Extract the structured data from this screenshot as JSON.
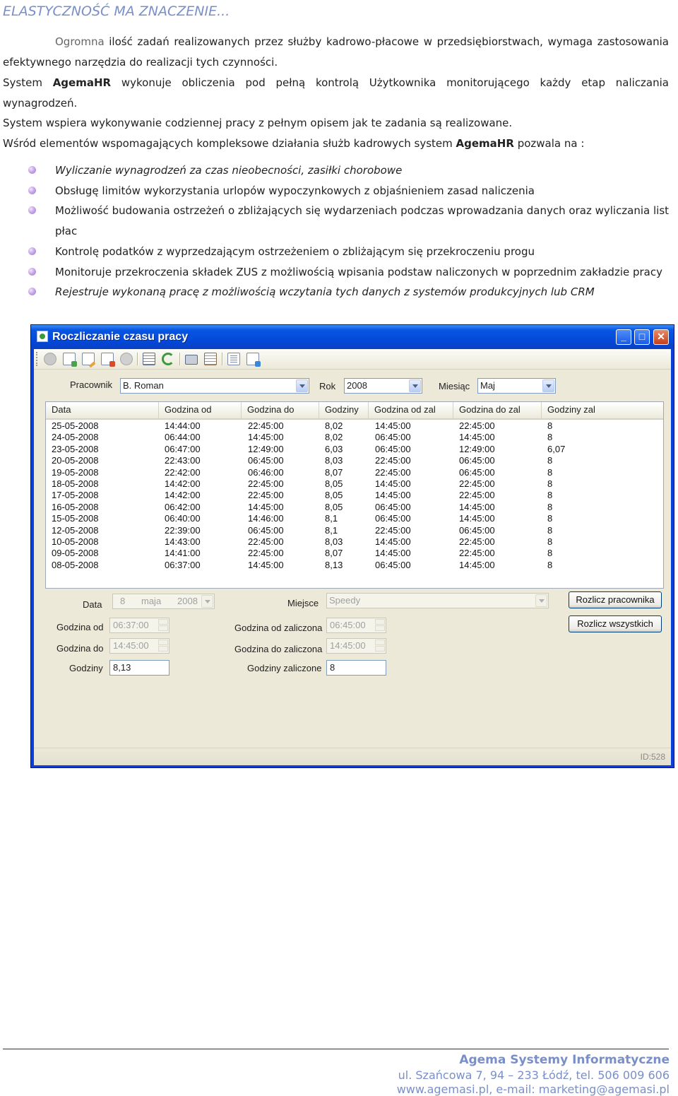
{
  "doc": {
    "title": "ELASTYCZNOŚĆ MA ZNACZENIE...",
    "p1_lead": "Ogromna",
    "p1_rest": " ilość zadań realizowanych przez służby kadrowo-płacowe w przedsiębiorstwach, wymaga zastosowania efektywnego narzędzia do realizacji tych czynności.",
    "p2_a": "System ",
    "p2_brand": "AgemaHR",
    "p2_b": " wykonuje obliczenia pod pełną kontrolą Użytkownika monitorującego każdy etap naliczania wynagrodzeń.",
    "p3": "System wspiera wykonywanie codziennej pracy  z pełnym opisem  jak te zadania są realizowane.",
    "p4_a": "Wśród elementów wspomagających kompleksowe działania  służb kadrowych system ",
    "p4_brand": "AgemaHR",
    "p4_b": " pozwala na :",
    "bullets": [
      "Wyliczanie wynagrodzeń za czas nieobecności, zasiłki chorobowe",
      "Obsługę limitów wykorzystania urlopów wypoczynkowych z objaśnieniem zasad naliczenia",
      "Możliwość budowania ostrzeżeń o zbliżających się wydarzeniach podczas wprowadzania danych oraz wyliczania list płac",
      "Kontrolę podatków z wyprzedzającym ostrzeżeniem o zbliżającym się przekroczeniu progu",
      "Monitoruje przekroczenia składek ZUS z możliwością wpisania podstaw naliczonych w poprzednim zakładzie pracy",
      "Rejestruje wykonaną pracę z możliwością wczytania tych danych z systemów produkcyjnych lub CRM"
    ]
  },
  "window": {
    "title": "Roczliczanie czasu pracy",
    "minimize": "_",
    "maximize": "□",
    "close": "✕",
    "filters": {
      "pracownik_label": "Pracownik",
      "pracownik_value": "B. Roman",
      "rok_label": "Rok",
      "rok_value": "2008",
      "miesiac_label": "Miesiąc",
      "miesiac_value": "Maj"
    },
    "columns": [
      "Data",
      "Godzina od",
      "Godzina do",
      "Godziny",
      "Godzina od zal",
      "Godzina do zal",
      "Godziny zal"
    ],
    "rows": [
      [
        "25-05-2008",
        "14:44:00",
        "22:45:00",
        "8,02",
        "14:45:00",
        "22:45:00",
        "8"
      ],
      [
        "24-05-2008",
        "06:44:00",
        "14:45:00",
        "8,02",
        "06:45:00",
        "14:45:00",
        "8"
      ],
      [
        "23-05-2008",
        "06:47:00",
        "12:49:00",
        "6,03",
        "06:45:00",
        "12:49:00",
        "6,07"
      ],
      [
        "20-05-2008",
        "22:43:00",
        "06:45:00",
        "8,03",
        "22:45:00",
        "06:45:00",
        "8"
      ],
      [
        "19-05-2008",
        "22:42:00",
        "06:46:00",
        "8,07",
        "22:45:00",
        "06:45:00",
        "8"
      ],
      [
        "18-05-2008",
        "14:42:00",
        "22:45:00",
        "8,05",
        "14:45:00",
        "22:45:00",
        "8"
      ],
      [
        "17-05-2008",
        "14:42:00",
        "22:45:00",
        "8,05",
        "14:45:00",
        "22:45:00",
        "8"
      ],
      [
        "16-05-2008",
        "06:42:00",
        "14:45:00",
        "8,05",
        "06:45:00",
        "14:45:00",
        "8"
      ],
      [
        "15-05-2008",
        "06:40:00",
        "14:46:00",
        "8,1",
        "06:45:00",
        "14:45:00",
        "8"
      ],
      [
        "12-05-2008",
        "22:39:00",
        "06:45:00",
        "8,1",
        "22:45:00",
        "06:45:00",
        "8"
      ],
      [
        "10-05-2008",
        "14:43:00",
        "22:45:00",
        "8,03",
        "14:45:00",
        "22:45:00",
        "8"
      ],
      [
        "09-05-2008",
        "14:41:00",
        "22:45:00",
        "8,07",
        "14:45:00",
        "22:45:00",
        "8"
      ],
      [
        "08-05-2008",
        "06:37:00",
        "14:45:00",
        "8,13",
        "06:45:00",
        "14:45:00",
        "8"
      ]
    ],
    "detail": {
      "data_label": "Data",
      "data_day": "8",
      "data_month": "maja",
      "data_year": "2008",
      "miejsce_label": "Miejsce",
      "miejsce_value": "Speedy",
      "godzina_od_label": "Godzina od",
      "godzina_od_value": "06:37:00",
      "godzina_do_label": "Godzina do",
      "godzina_do_value": "14:45:00",
      "godziny_label": "Godziny",
      "godziny_value": "8,13",
      "godzina_od_zal_label": "Godzina od zaliczona",
      "godzina_od_zal_value": "06:45:00",
      "godzina_do_zal_label": "Godzina do zaliczona",
      "godzina_do_zal_value": "14:45:00",
      "godziny_zal_label": "Godziny zaliczone",
      "godziny_zal_value": "8",
      "btn_rozlicz_pracownika": "Rozlicz pracownika",
      "btn_rozlicz_wszystkich": "Rozlicz wszystkich"
    },
    "status_id": "ID:528"
  },
  "footer": {
    "company": "Agema Systemy Informatyczne",
    "address": "ul. Szańcowa 7, 94 – 233 Łódź,  tel. 506 009 606",
    "web": "www.agemasi.pl, e-mail: marketing@agemasi.pl"
  }
}
